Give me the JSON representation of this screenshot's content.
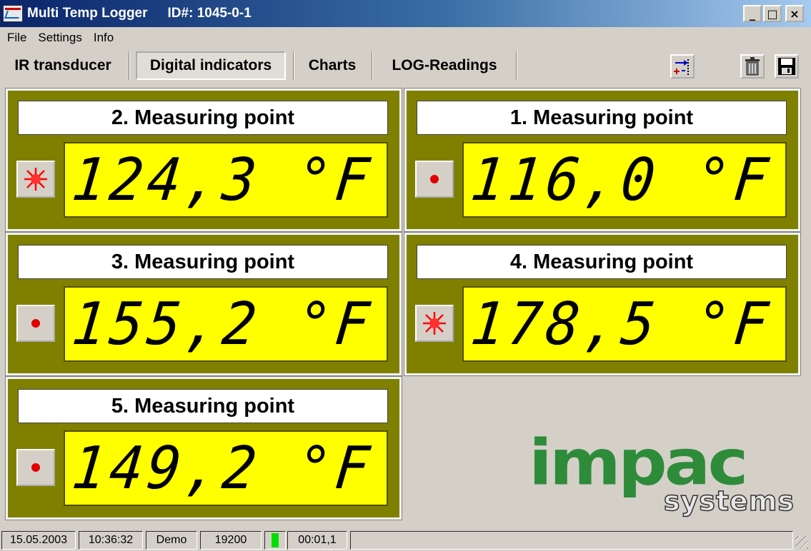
{
  "window": {
    "title": "Multi Temp Logger",
    "id_label": "ID#: 1045-0-1",
    "minimize": "_",
    "maximize": "□",
    "close": "×"
  },
  "menu": {
    "items": [
      {
        "label": "File"
      },
      {
        "label": "Settings"
      },
      {
        "label": "Info"
      }
    ]
  },
  "tabs": [
    {
      "label": "IR transducer",
      "active": false
    },
    {
      "label": "Digital indicators",
      "active": true
    },
    {
      "label": "Charts",
      "active": false
    },
    {
      "label": "LOG-Readings",
      "active": false
    }
  ],
  "toolbar": {
    "buttons": [
      "transfer-icon",
      "trash-icon",
      "save-icon"
    ]
  },
  "measuring_points": [
    {
      "label": "2. Measuring point",
      "value": "124,3 °F",
      "indicator": "alarm-sun-icon"
    },
    {
      "label": "1. Measuring point",
      "value": "116,0 °F",
      "indicator": "status-dot-icon"
    },
    {
      "label": "3. Measuring point",
      "value": "155,2 °F",
      "indicator": "status-dot-icon"
    },
    {
      "label": "4. Measuring point",
      "value": "178,5 °F",
      "indicator": "alarm-sun-icon"
    },
    {
      "label": "5. Measuring point",
      "value": "149,2 °F",
      "indicator": "status-dot-icon"
    }
  ],
  "logo": {
    "main": "impac",
    "sub": "systems",
    "color": "#2e8b3a"
  },
  "statusbar": {
    "date": "15.05.2003",
    "time": "10:36:32",
    "mode": "Demo",
    "baud": "19200",
    "elapsed": "00:01,1",
    "led_color": "#00dd00"
  },
  "colors": {
    "display": "#ffff00",
    "panel": "#808000",
    "alarm": "#e00000"
  }
}
